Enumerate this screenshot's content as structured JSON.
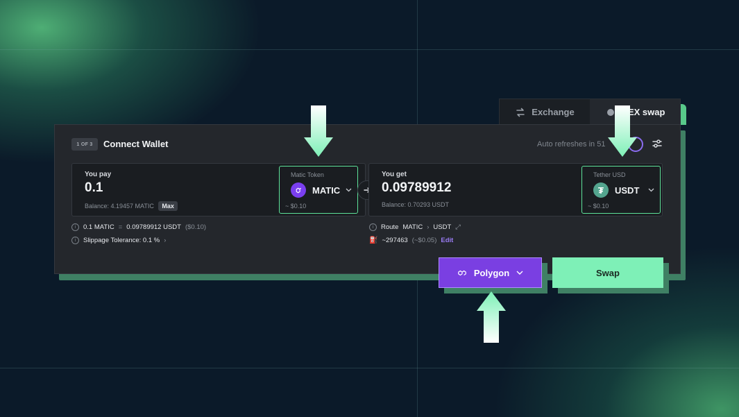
{
  "tabs": [
    {
      "label": "Exchange",
      "icon": "swap-arrows-icon",
      "active": false
    },
    {
      "label": "DEX swap",
      "icon": "wallet-icon",
      "active": true
    }
  ],
  "header": {
    "step": "1 OF 3",
    "title": "Connect Wallet",
    "auto_refresh": "Auto refreshes in 51"
  },
  "pay": {
    "label": "You pay",
    "amount": "0.1",
    "balance": "Balance: 4.19457 MATIC",
    "max_label": "Max",
    "token": {
      "name": "Matic Token",
      "symbol": "MATIC",
      "usd": "~ $0.10",
      "icon": "polygon-icon",
      "color": "#7a3ff0"
    }
  },
  "get": {
    "label": "You get",
    "amount": "0.09789912",
    "balance": "Balance: 0.70293 USDT",
    "token": {
      "name": "Tether USD",
      "symbol": "USDT",
      "usd": "~ $0.10",
      "icon": "tether-icon",
      "color": "#54a58f"
    }
  },
  "info": {
    "rate_from": "0.1 MATIC",
    "rate_sep": "=",
    "rate_to": "0.09789912 USDT",
    "rate_usd": "($0.10)",
    "slippage": "Slippage Tolerance: 0.1 %",
    "route_label": "Route",
    "route_from": "MATIC",
    "route_to": "USDT",
    "gas": "~297463",
    "gas_usd": "(~$0.05)",
    "edit": "Edit"
  },
  "actions": {
    "network": "Polygon",
    "swap": "Swap"
  },
  "colors": {
    "accent_green": "#7ef0b7",
    "highlight_green": "#5ee39a",
    "polygon_purple": "#7a3fe2",
    "card_bg": "#24272c",
    "page_bg": "#0b1a29"
  }
}
